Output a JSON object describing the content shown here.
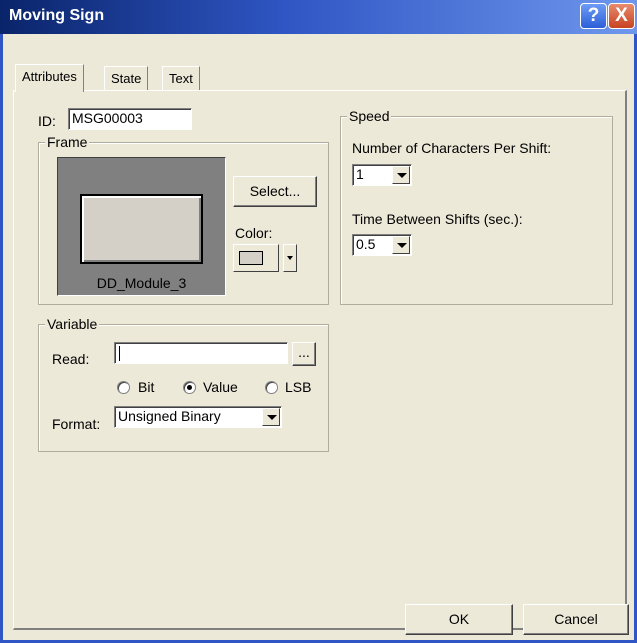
{
  "window": {
    "title": "Moving Sign",
    "help_label": "?",
    "close_label": "X"
  },
  "tabs": [
    {
      "label": "Attributes",
      "active": true
    },
    {
      "label": "State",
      "active": false
    },
    {
      "label": "Text",
      "active": false
    }
  ],
  "attributes": {
    "id_label": "ID:",
    "id_value": "MSG00003",
    "frame": {
      "group_label": "Frame",
      "preview_caption": "DD_Module_3",
      "select_button": "Select...",
      "color_label": "Color:",
      "color_value": "#d4d0c8"
    },
    "speed": {
      "group_label": "Speed",
      "chars_label": "Number of Characters Per Shift:",
      "chars_value": "1",
      "time_label": "Time Between Shifts (sec.):",
      "time_value": "0.5"
    },
    "variable": {
      "group_label": "Variable",
      "read_label": "Read:",
      "read_value": "",
      "browse_button": "...",
      "radio_options": [
        {
          "label": "Bit",
          "checked": false
        },
        {
          "label": "Value",
          "checked": true
        },
        {
          "label": "LSB",
          "checked": false
        }
      ],
      "format_label": "Format:",
      "format_value": "Unsigned Binary"
    }
  },
  "buttons": {
    "ok": "OK",
    "cancel": "Cancel"
  }
}
